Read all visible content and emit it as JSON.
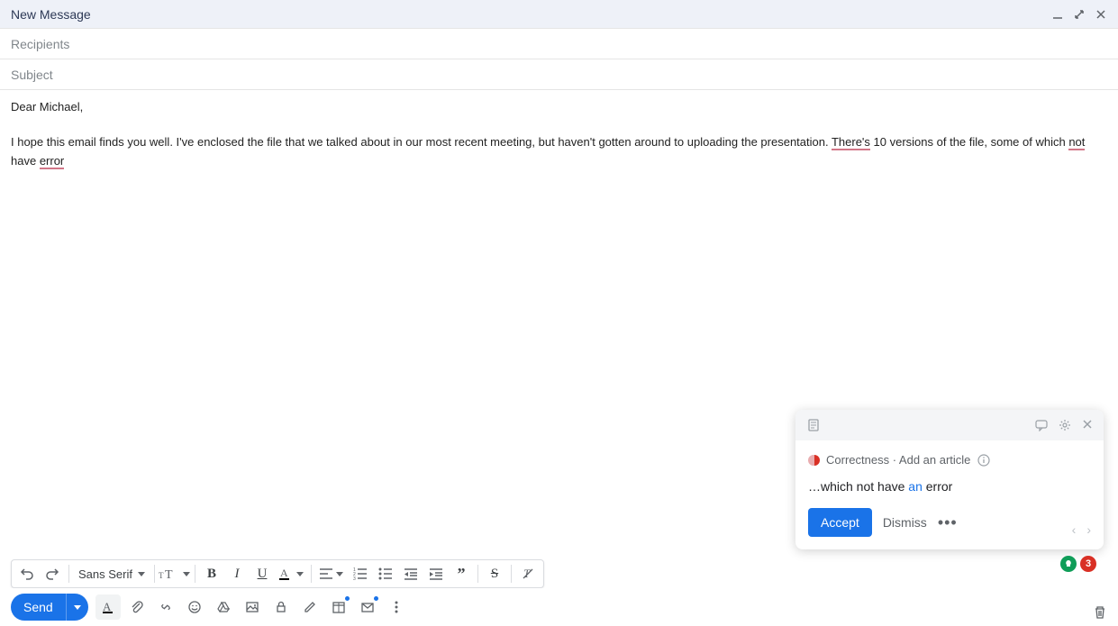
{
  "header": {
    "title": "New Message"
  },
  "fields": {
    "recipients_placeholder": "Recipients",
    "subject_placeholder": "Subject"
  },
  "body": {
    "greeting": "Dear Michael,",
    "p1_a": "I hope this email finds you well. I've enclosed the file that we talked about in our most recent meeting, but haven't gotten around to uploading the presentation. ",
    "p1_err1": "There's",
    "p1_b": " 10 versions of the file, some of which ",
    "p1_err2": "not",
    "p1_c": " have ",
    "p1_err3": "error"
  },
  "toolbar": {
    "font": "Sans Serif"
  },
  "send": {
    "label": "Send"
  },
  "grammar": {
    "category": "Correctness · Add an article",
    "before": "…which not have ",
    "insert": "an",
    "after": " error",
    "accept": "Accept",
    "dismiss": "Dismiss"
  },
  "badge_count": "3"
}
